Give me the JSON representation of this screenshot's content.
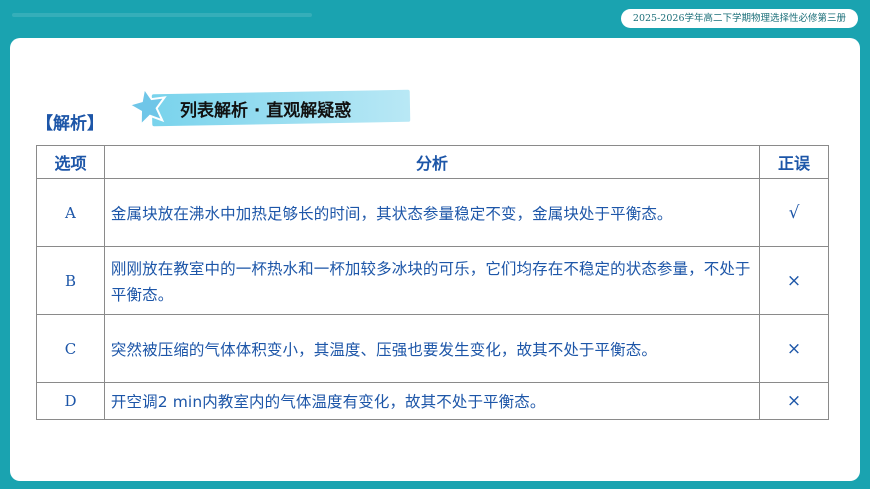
{
  "header": {
    "course": "2025-2026学年高二下学期物理选择性必修第三册"
  },
  "section": {
    "label": "【解析】",
    "banner": "列表解析 · 直观解疑惑"
  },
  "table": {
    "headers": [
      "选项",
      "分析",
      "正误"
    ],
    "rows": [
      {
        "option": "A",
        "analysis": "金属块放在沸水中加热足够长的时间，其状态参量稳定不变，金属块处于平衡态。",
        "result": "√"
      },
      {
        "option": "B",
        "analysis": "刚刚放在教室中的一杯热水和一杯加较多冰块的可乐，它们均存在不稳定的状态参量，不处于平衡态。",
        "result": "×"
      },
      {
        "option": "C",
        "analysis": "突然被压缩的气体体积变小，其温度、压强也要发生变化，故其不处于平衡态。",
        "result": "×"
      },
      {
        "option": "D",
        "analysis": "开空调2 min内教室内的气体温度有变化，故其不处于平衡态。",
        "result": "×"
      }
    ]
  },
  "colors": {
    "frame": "#1aa3b0",
    "text_blue": "#1d56a8",
    "banner": "#79d3ec"
  }
}
